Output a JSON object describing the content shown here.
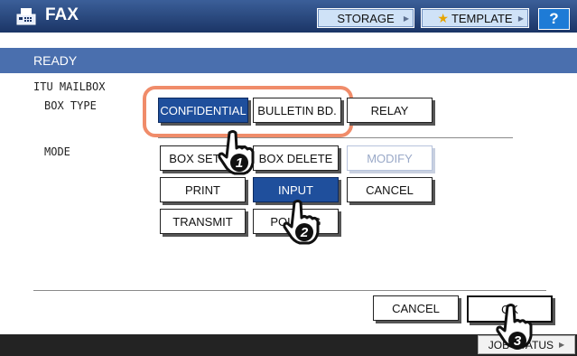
{
  "header": {
    "title": "FAX",
    "storage_label": "STORAGE",
    "template_label": "TEMPLATE",
    "help_label": "?",
    "app_icon": "fax-machine-icon"
  },
  "status": {
    "text": "READY"
  },
  "section": {
    "title": "ITU MAILBOX",
    "box_type_label": "BOX TYPE",
    "mode_label": "MODE"
  },
  "box_type": {
    "confidential": "CONFIDENTIAL",
    "bulletin": "BULLETIN BD.",
    "relay": "RELAY",
    "selected": "CONFIDENTIAL"
  },
  "mode": {
    "box_setup": "BOX SETUP",
    "box_delete": "BOX DELETE",
    "modify": "MODIFY",
    "print": "PRINT",
    "input": "INPUT",
    "cancel": "CANCEL",
    "transmit": "TRANSMIT",
    "polling": "POLLING",
    "selected": "INPUT"
  },
  "footer": {
    "cancel": "CANCEL",
    "ok": "OK",
    "job_status": "JOB STATUS"
  },
  "steps": [
    "1",
    "2",
    "3"
  ],
  "colors": {
    "title_bar": "#1b3566",
    "status_bar": "#4a6fae",
    "selected_button": "#1f4f9c",
    "highlight_outline": "#f08c6a",
    "help_button": "#1e7bd6"
  }
}
